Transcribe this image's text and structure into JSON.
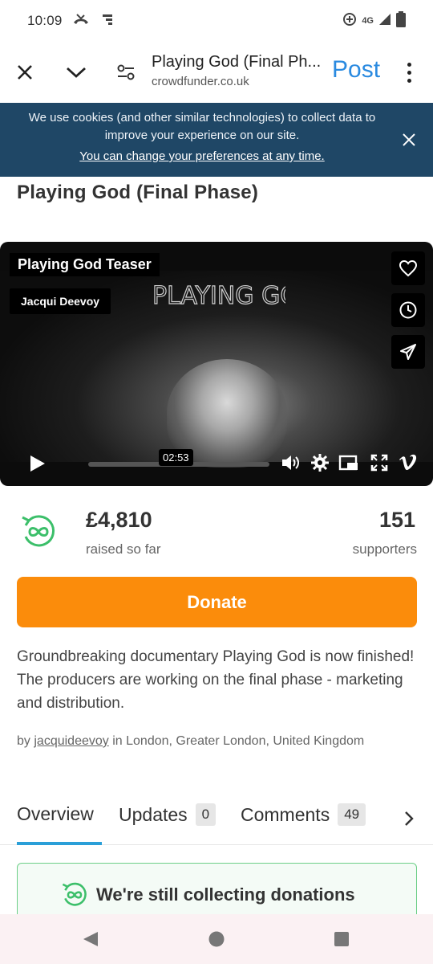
{
  "status_bar": {
    "time": "10:09",
    "network": "4G"
  },
  "browser": {
    "page_title": "Playing God (Final Ph...",
    "url": "crowdfunder.co.uk",
    "post_label": "Post"
  },
  "cookie_banner": {
    "text": "We use cookies (and other similar technologies) to collect data to improve your experience on our site.",
    "link": "You can change your preferences at any time."
  },
  "project": {
    "title": "Playing God (Final Phase)",
    "video": {
      "title": "Playing God Teaser",
      "author": "Jacqui Deevoy",
      "overlay_text": "PLAYING GOD",
      "time": "02:53"
    },
    "raised_amount": "£4,810",
    "raised_label": "raised so far",
    "supporters_count": "151",
    "supporters_label": "supporters",
    "donate_label": "Donate",
    "description": "Groundbreaking documentary Playing God is now finished! The producers are working on the final phase - marketing and distribution.",
    "by_prefix": "by",
    "author_link": "jacquideevoy",
    "location": "in London, Greater London, United Kingdom"
  },
  "tabs": [
    {
      "label": "Overview",
      "active": true
    },
    {
      "label": "Updates",
      "count": "0"
    },
    {
      "label": "Comments",
      "count": "49"
    }
  ],
  "collecting_panel": {
    "text": "We're still collecting donations"
  },
  "colors": {
    "accent_orange": "#fb8c0b",
    "banner_navy": "#1f4766",
    "link_blue": "#2a8ae0",
    "success_green": "#3cbf6a"
  }
}
